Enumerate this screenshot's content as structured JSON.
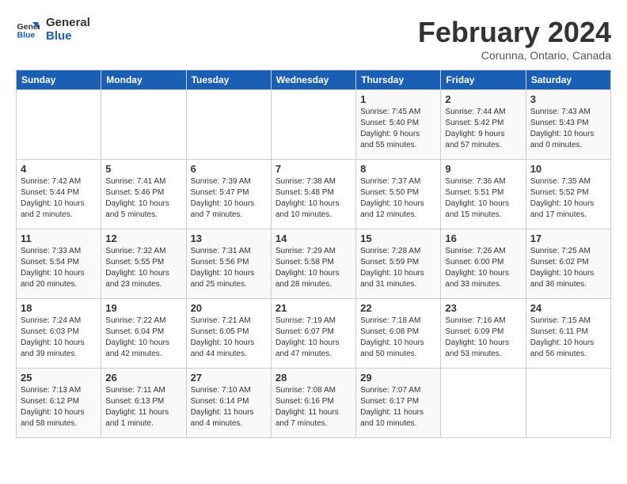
{
  "logo": {
    "line1": "General",
    "line2": "Blue"
  },
  "title": "February 2024",
  "subtitle": "Corunna, Ontario, Canada",
  "days_header": [
    "Sunday",
    "Monday",
    "Tuesday",
    "Wednesday",
    "Thursday",
    "Friday",
    "Saturday"
  ],
  "weeks": [
    [
      {
        "day": "",
        "info": ""
      },
      {
        "day": "",
        "info": ""
      },
      {
        "day": "",
        "info": ""
      },
      {
        "day": "",
        "info": ""
      },
      {
        "day": "1",
        "info": "Sunrise: 7:45 AM\nSunset: 5:40 PM\nDaylight: 9 hours\nand 55 minutes."
      },
      {
        "day": "2",
        "info": "Sunrise: 7:44 AM\nSunset: 5:42 PM\nDaylight: 9 hours\nand 57 minutes."
      },
      {
        "day": "3",
        "info": "Sunrise: 7:43 AM\nSunset: 5:43 PM\nDaylight: 10 hours\nand 0 minutes."
      }
    ],
    [
      {
        "day": "4",
        "info": "Sunrise: 7:42 AM\nSunset: 5:44 PM\nDaylight: 10 hours\nand 2 minutes."
      },
      {
        "day": "5",
        "info": "Sunrise: 7:41 AM\nSunset: 5:46 PM\nDaylight: 10 hours\nand 5 minutes."
      },
      {
        "day": "6",
        "info": "Sunrise: 7:39 AM\nSunset: 5:47 PM\nDaylight: 10 hours\nand 7 minutes."
      },
      {
        "day": "7",
        "info": "Sunrise: 7:38 AM\nSunset: 5:48 PM\nDaylight: 10 hours\nand 10 minutes."
      },
      {
        "day": "8",
        "info": "Sunrise: 7:37 AM\nSunset: 5:50 PM\nDaylight: 10 hours\nand 12 minutes."
      },
      {
        "day": "9",
        "info": "Sunrise: 7:36 AM\nSunset: 5:51 PM\nDaylight: 10 hours\nand 15 minutes."
      },
      {
        "day": "10",
        "info": "Sunrise: 7:35 AM\nSunset: 5:52 PM\nDaylight: 10 hours\nand 17 minutes."
      }
    ],
    [
      {
        "day": "11",
        "info": "Sunrise: 7:33 AM\nSunset: 5:54 PM\nDaylight: 10 hours\nand 20 minutes."
      },
      {
        "day": "12",
        "info": "Sunrise: 7:32 AM\nSunset: 5:55 PM\nDaylight: 10 hours\nand 23 minutes."
      },
      {
        "day": "13",
        "info": "Sunrise: 7:31 AM\nSunset: 5:56 PM\nDaylight: 10 hours\nand 25 minutes."
      },
      {
        "day": "14",
        "info": "Sunrise: 7:29 AM\nSunset: 5:58 PM\nDaylight: 10 hours\nand 28 minutes."
      },
      {
        "day": "15",
        "info": "Sunrise: 7:28 AM\nSunset: 5:59 PM\nDaylight: 10 hours\nand 31 minutes."
      },
      {
        "day": "16",
        "info": "Sunrise: 7:26 AM\nSunset: 6:00 PM\nDaylight: 10 hours\nand 33 minutes."
      },
      {
        "day": "17",
        "info": "Sunrise: 7:25 AM\nSunset: 6:02 PM\nDaylight: 10 hours\nand 36 minutes."
      }
    ],
    [
      {
        "day": "18",
        "info": "Sunrise: 7:24 AM\nSunset: 6:03 PM\nDaylight: 10 hours\nand 39 minutes."
      },
      {
        "day": "19",
        "info": "Sunrise: 7:22 AM\nSunset: 6:04 PM\nDaylight: 10 hours\nand 42 minutes."
      },
      {
        "day": "20",
        "info": "Sunrise: 7:21 AM\nSunset: 6:05 PM\nDaylight: 10 hours\nand 44 minutes."
      },
      {
        "day": "21",
        "info": "Sunrise: 7:19 AM\nSunset: 6:07 PM\nDaylight: 10 hours\nand 47 minutes."
      },
      {
        "day": "22",
        "info": "Sunrise: 7:18 AM\nSunset: 6:08 PM\nDaylight: 10 hours\nand 50 minutes."
      },
      {
        "day": "23",
        "info": "Sunrise: 7:16 AM\nSunset: 6:09 PM\nDaylight: 10 hours\nand 53 minutes."
      },
      {
        "day": "24",
        "info": "Sunrise: 7:15 AM\nSunset: 6:11 PM\nDaylight: 10 hours\nand 56 minutes."
      }
    ],
    [
      {
        "day": "25",
        "info": "Sunrise: 7:13 AM\nSunset: 6:12 PM\nDaylight: 10 hours\nand 58 minutes."
      },
      {
        "day": "26",
        "info": "Sunrise: 7:11 AM\nSunset: 6:13 PM\nDaylight: 11 hours\nand 1 minute."
      },
      {
        "day": "27",
        "info": "Sunrise: 7:10 AM\nSunset: 6:14 PM\nDaylight: 11 hours\nand 4 minutes."
      },
      {
        "day": "28",
        "info": "Sunrise: 7:08 AM\nSunset: 6:16 PM\nDaylight: 11 hours\nand 7 minutes."
      },
      {
        "day": "29",
        "info": "Sunrise: 7:07 AM\nSunset: 6:17 PM\nDaylight: 11 hours\nand 10 minutes."
      },
      {
        "day": "",
        "info": ""
      },
      {
        "day": "",
        "info": ""
      }
    ]
  ]
}
